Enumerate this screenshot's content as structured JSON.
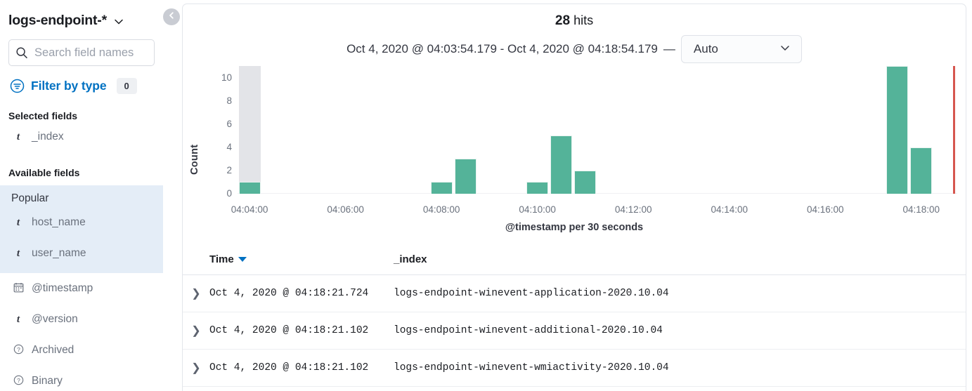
{
  "sidebar": {
    "index_pattern": "logs-endpoint-*",
    "index_pattern_chevron_icon": "chevron-down-icon",
    "search": {
      "placeholder": "Search field names",
      "value": "",
      "icon": "search-icon"
    },
    "filter": {
      "icon": "filter-icon",
      "label": "Filter by type",
      "badge": "0"
    },
    "selected_fields_title": "Selected fields",
    "selected_fields": [
      {
        "type_icon": "t",
        "label": "_index"
      }
    ],
    "available_fields_title": "Available fields",
    "popular_label": "Popular",
    "popular_fields": [
      {
        "type_icon": "t",
        "label": "host_name"
      },
      {
        "type_icon": "t",
        "label": "user_name"
      }
    ],
    "available_fields": [
      {
        "type_icon": "calendar",
        "label": "@timestamp"
      },
      {
        "type_icon": "t",
        "label": "@version"
      },
      {
        "type_icon": "question",
        "label": "Archived"
      },
      {
        "type_icon": "question",
        "label": "Binary"
      }
    ],
    "collapse_button_icon": "chevron-left-icon"
  },
  "header": {
    "hits_count": "28",
    "hits_word": "hits",
    "time_range": "Oct 4, 2020 @ 04:03:54.179 - Oct 4, 2020 @ 04:18:54.179",
    "dash": "—",
    "interval_value": "Auto",
    "interval_chevron_icon": "chevron-down-icon"
  },
  "chart_data": {
    "type": "bar",
    "title": "",
    "xlabel": "@timestamp per 30 seconds",
    "ylabel": "Count",
    "ylim": [
      0,
      11
    ],
    "yticks": [
      0,
      2,
      4,
      6,
      8,
      10
    ],
    "xticks": [
      "04:04:00",
      "04:06:00",
      "04:08:00",
      "04:10:00",
      "04:12:00",
      "04:14:00",
      "04:16:00",
      "04:18:00"
    ],
    "grid": false,
    "legend": false,
    "bar_color": "#54b399",
    "hover_highlight_color": "#e3e4e8",
    "marker_color": "#d6564f",
    "categories": [
      "04:04:00",
      "04:04:30",
      "04:05:00",
      "04:05:30",
      "04:06:00",
      "04:06:30",
      "04:07:00",
      "04:07:30",
      "04:08:00",
      "04:08:30",
      "04:09:00",
      "04:09:30",
      "04:10:00",
      "04:10:30",
      "04:11:00",
      "04:11:30",
      "04:12:00",
      "04:12:30",
      "04:13:00",
      "04:13:30",
      "04:14:00",
      "04:14:30",
      "04:15:00",
      "04:15:30",
      "04:16:00",
      "04:16:30",
      "04:17:00",
      "04:17:30",
      "04:18:00",
      "04:18:30"
    ],
    "values": [
      1,
      0,
      0,
      0,
      0,
      0,
      0,
      0,
      1,
      3,
      0,
      0,
      1,
      5,
      2,
      0,
      0,
      0,
      0,
      0,
      0,
      0,
      0,
      0,
      0,
      0,
      0,
      11,
      4,
      0
    ],
    "hovered_category": "04:04:00",
    "marker_category": "04:18:54"
  },
  "table": {
    "columns": [
      {
        "key": "expand",
        "label": ""
      },
      {
        "key": "time",
        "label": "Time",
        "sorted": "desc",
        "sort_icon": "sort-down-icon"
      },
      {
        "key": "index",
        "label": "_index"
      }
    ],
    "rows": [
      {
        "expand_icon": "chevron-right-icon",
        "time": "Oct 4, 2020 @ 04:18:21.724",
        "index": "logs-endpoint-winevent-application-2020.10.04"
      },
      {
        "expand_icon": "chevron-right-icon",
        "time": "Oct 4, 2020 @ 04:18:21.102",
        "index": "logs-endpoint-winevent-additional-2020.10.04"
      },
      {
        "expand_icon": "chevron-right-icon",
        "time": "Oct 4, 2020 @ 04:18:21.102",
        "index": "logs-endpoint-winevent-wmiactivity-2020.10.04"
      }
    ]
  },
  "colors": {
    "accent_blue": "#0071c2",
    "bar_green": "#54b399",
    "marker_red": "#d6564f",
    "popular_bg": "#e4edf7"
  }
}
